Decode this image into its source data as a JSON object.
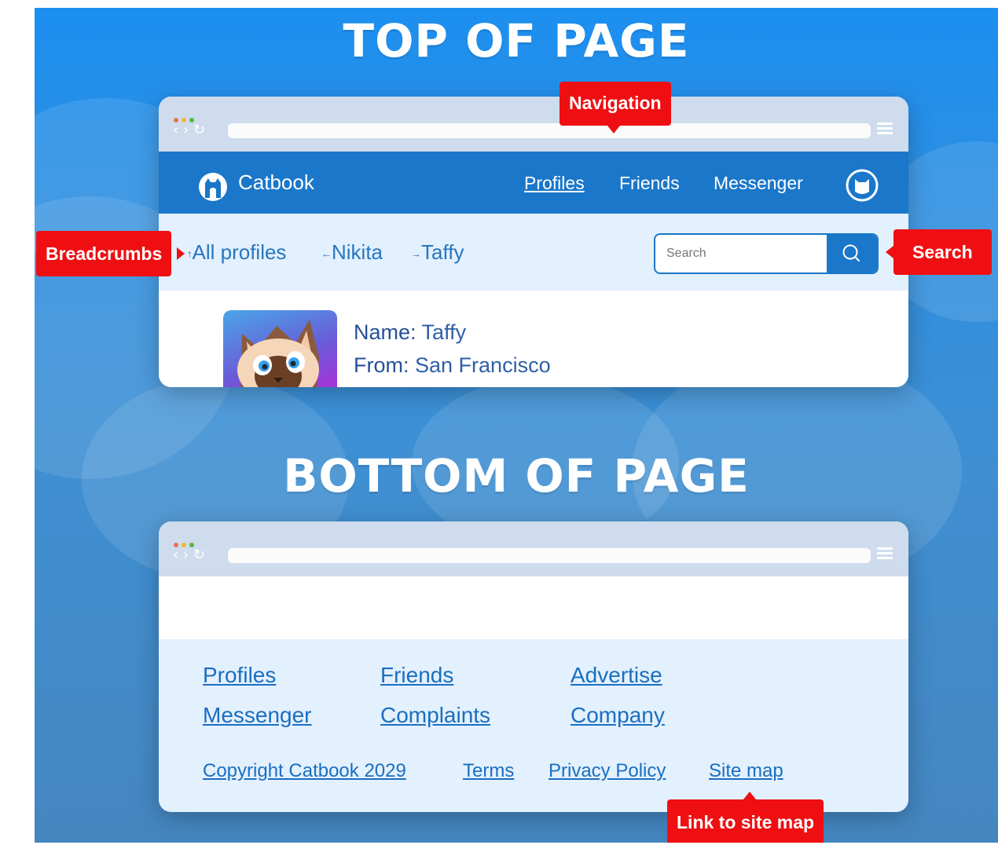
{
  "headings": {
    "top": "TOP OF PAGE",
    "bottom": "BOTTOM OF PAGE"
  },
  "colors": {
    "nav_blue": "#1a77c9",
    "link_blue": "#1a6fc0",
    "callout_red": "#ef0f12",
    "light_panel": "#e3f0fd",
    "chrome": "#cfdced"
  },
  "browser": {
    "dots": [
      "#e8734a",
      "#f2b632",
      "#53b848"
    ],
    "controls": "‹ › ↻",
    "menu_icon": "hamburger-icon"
  },
  "navbar": {
    "brand": "Catbook",
    "links": [
      {
        "label": "Profiles",
        "active": true
      },
      {
        "label": "Friends",
        "active": false
      },
      {
        "label": "Messenger",
        "active": false
      }
    ],
    "avatar_icon": "cat-avatar-icon"
  },
  "breadcrumbs": [
    {
      "arrow": "↑",
      "label": "All profiles"
    },
    {
      "arrow": "←",
      "label": "Nikita"
    },
    {
      "arrow": "→",
      "label": "Taffy"
    }
  ],
  "search": {
    "placeholder": "Search",
    "icon": "search-icon"
  },
  "profile": {
    "name_label": "Name:",
    "name_value": "Taffy",
    "from_label": "From:",
    "from_value": "San Francisco"
  },
  "footer": {
    "links": [
      "Profiles",
      "Friends",
      "Advertise",
      "Messenger",
      "Complaints",
      "Company"
    ],
    "secondary": [
      "Copyright Catbook 2029",
      "Terms",
      "Privacy Policy",
      "Site map"
    ]
  },
  "callouts": {
    "navigation": "Navigation",
    "breadcrumbs": "Breadcrumbs",
    "search": "Search",
    "sitemap": "Link to site map"
  }
}
